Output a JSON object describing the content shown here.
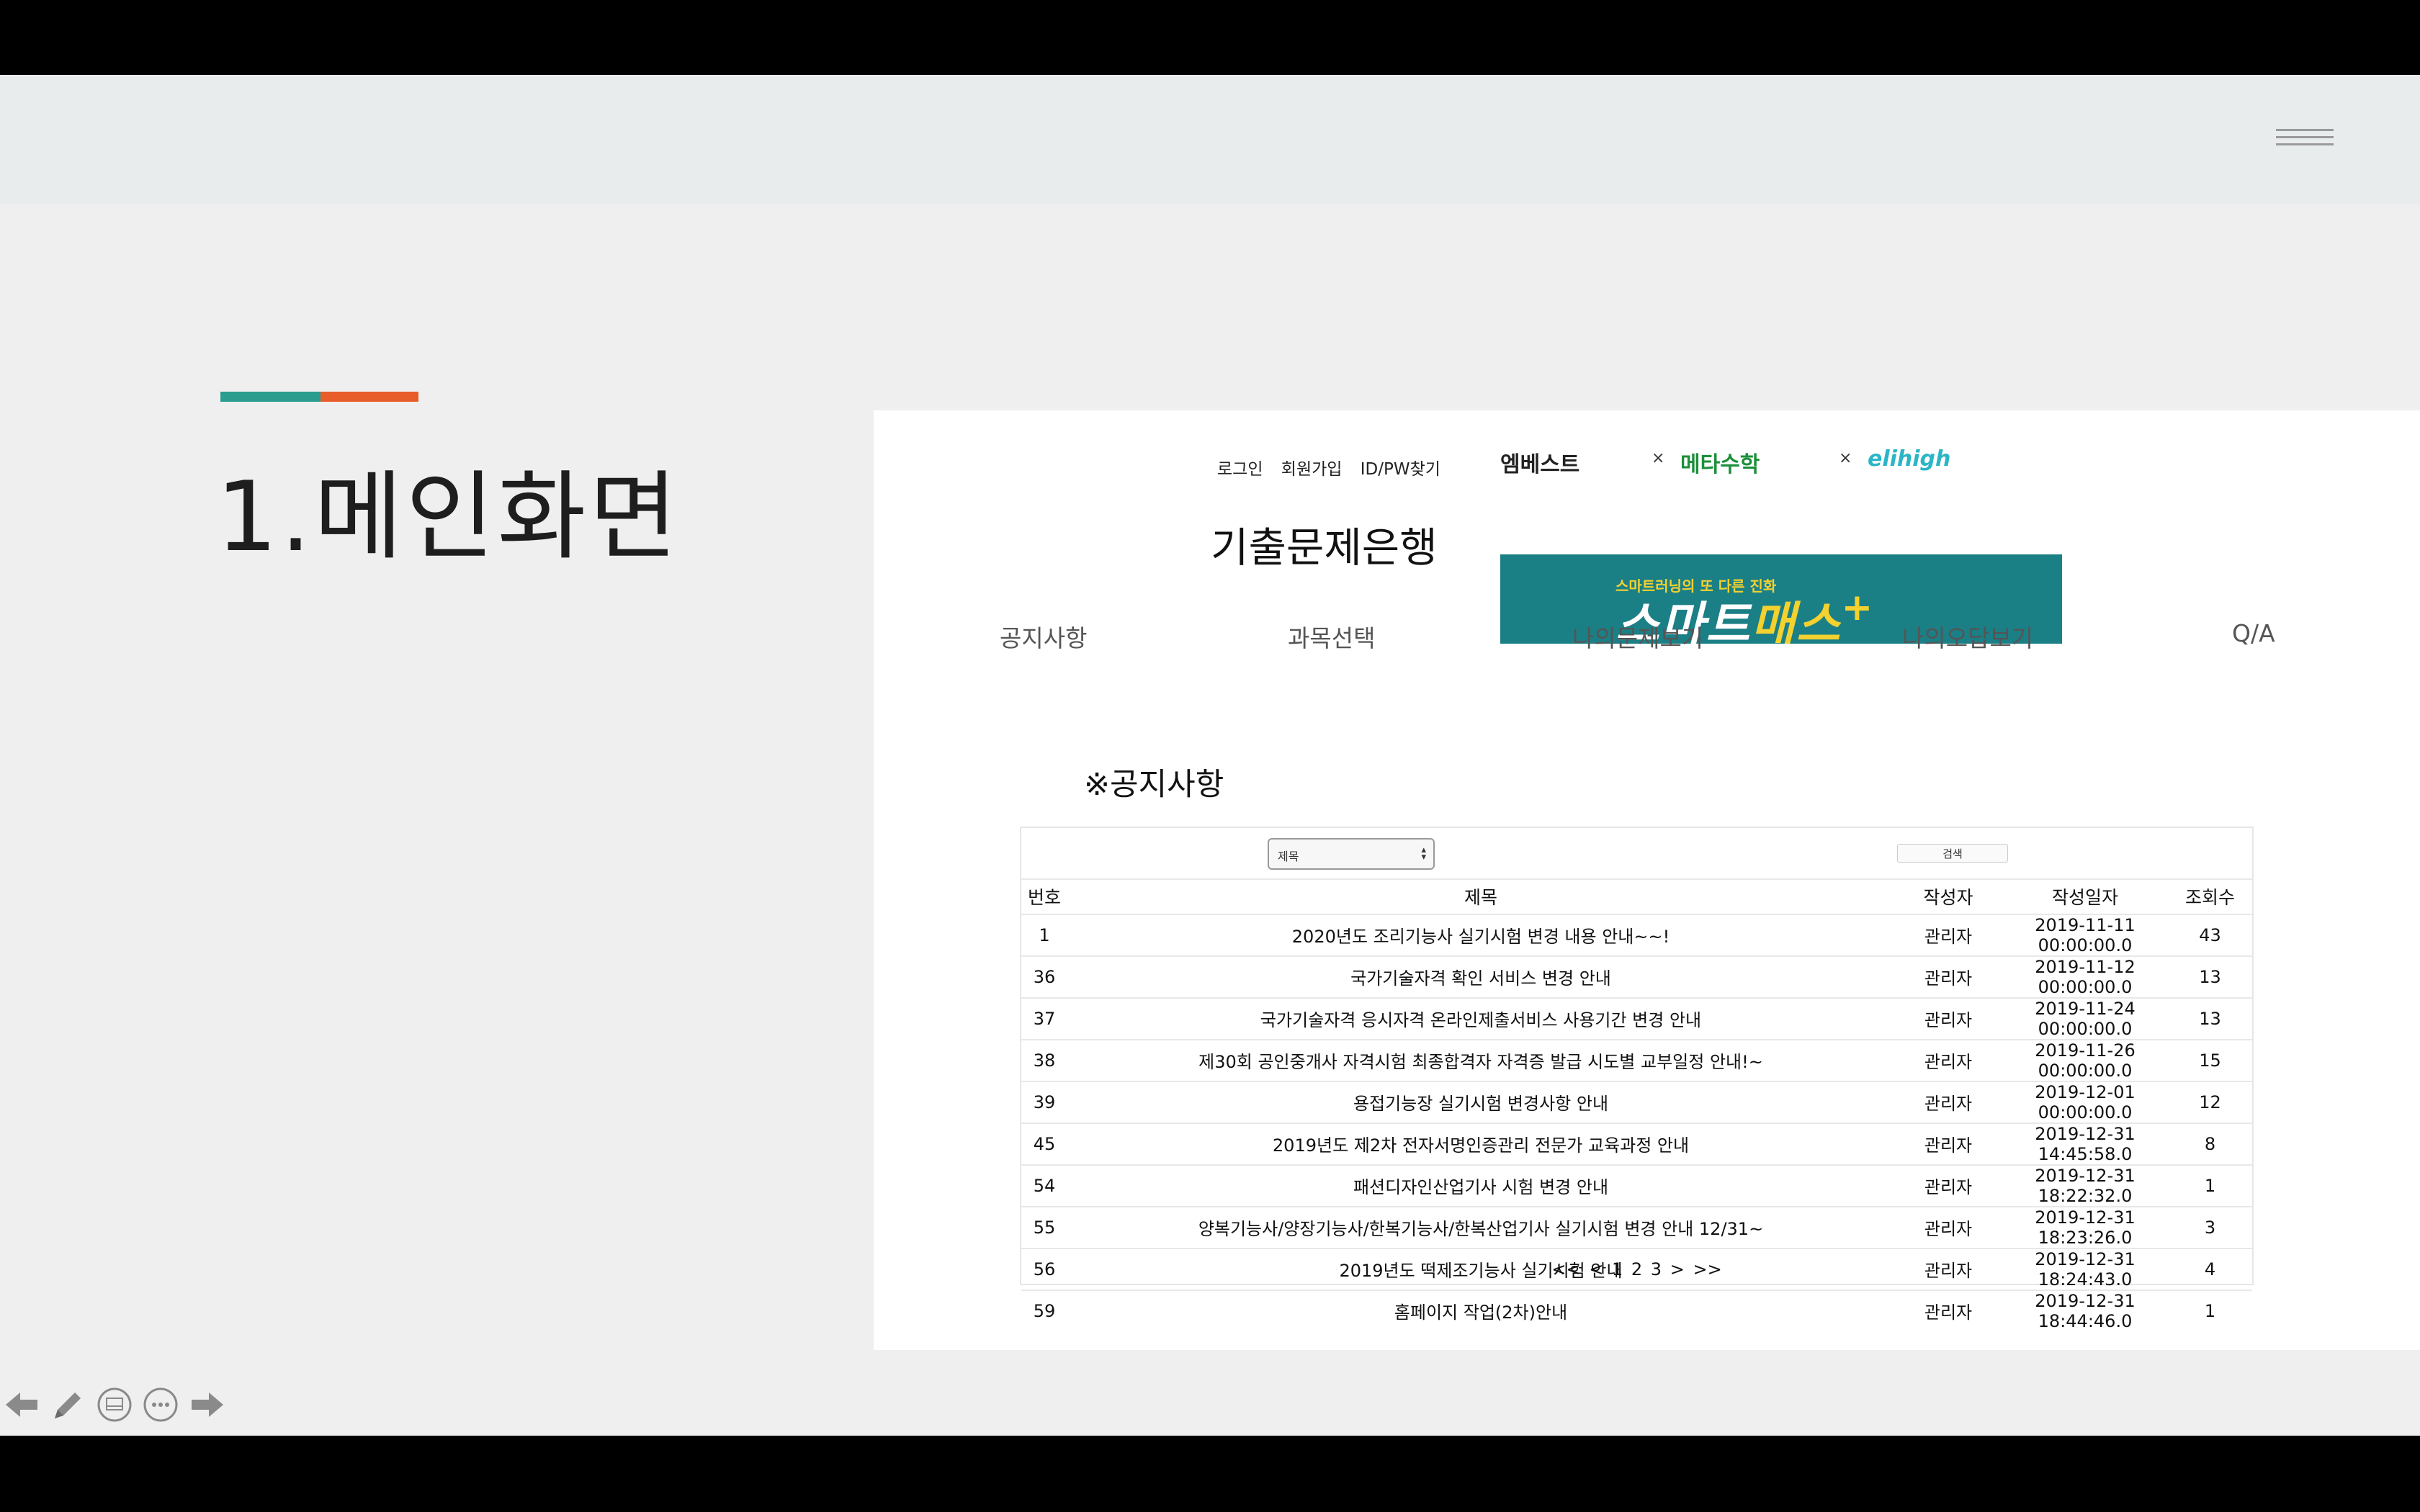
{
  "slide": {
    "title": "1.메인화면",
    "accent_colors": [
      "#2a9d8f",
      "#e85d2a"
    ]
  },
  "site": {
    "top_links": [
      "로그인",
      "회원가입",
      "ID/PW찾기"
    ],
    "title": "기출문제은행",
    "partners": [
      "엠베스트",
      "×",
      "메타수학",
      "×",
      "elihigh"
    ],
    "banner": {
      "subtitle": "스마트러닝의 또 다른 진화",
      "main_a": "스마트",
      "main_b": "매스",
      "plus": "+"
    },
    "nav": [
      "공지사항",
      "과목선택",
      "나의문제보기",
      "나의오답보기",
      "Q/A"
    ]
  },
  "notice": {
    "heading": "※공지사항",
    "filter_value": "제목",
    "search_button": "검색",
    "columns": [
      "번호",
      "제목",
      "작성자",
      "작성일자",
      "조회수"
    ],
    "rows": [
      [
        "1",
        "2020년도 조리기능사 실기시험 변경 내용 안내~~!",
        "관리자",
        "2019-11-11 00:00:00.0",
        "43"
      ],
      [
        "36",
        "국가기술자격 확인 서비스 변경 안내",
        "관리자",
        "2019-11-12 00:00:00.0",
        "13"
      ],
      [
        "37",
        "국가기술자격 응시자격 온라인제출서비스 사용기간 변경 안내",
        "관리자",
        "2019-11-24 00:00:00.0",
        "13"
      ],
      [
        "38",
        "제30회 공인중개사 자격시험 최종합격자 자격증 발급 시도별 교부일정 안내!~",
        "관리자",
        "2019-11-26 00:00:00.0",
        "15"
      ],
      [
        "39",
        "용접기능장 실기시험 변경사항 안내",
        "관리자",
        "2019-12-01 00:00:00.0",
        "12"
      ],
      [
        "45",
        "2019년도 제2차 전자서명인증관리 전문가 교육과정 안내",
        "관리자",
        "2019-12-31 14:45:58.0",
        "8"
      ],
      [
        "54",
        "패션디자인산업기사 시험 변경 안내",
        "관리자",
        "2019-12-31 18:22:32.0",
        "1"
      ],
      [
        "55",
        "양복기능사/양장기능사/한복기능사/한복산업기사 실기시험 변경 안내 12/31~",
        "관리자",
        "2019-12-31 18:23:26.0",
        "3"
      ],
      [
        "56",
        "2019년도 떡제조기능사 실기시험 안내",
        "관리자",
        "2019-12-31 18:24:43.0",
        "4"
      ],
      [
        "59",
        "홈페이지 작업(2차)안내",
        "관리자",
        "2019-12-31 18:44:46.0",
        "1"
      ]
    ],
    "pagination": [
      "<<",
      "<",
      "1",
      "2",
      "3",
      ">",
      ">>"
    ]
  },
  "controls": {
    "icons": [
      "prev-arrow-icon",
      "pen-icon",
      "slides-icon",
      "more-icon",
      "next-arrow-icon"
    ]
  }
}
